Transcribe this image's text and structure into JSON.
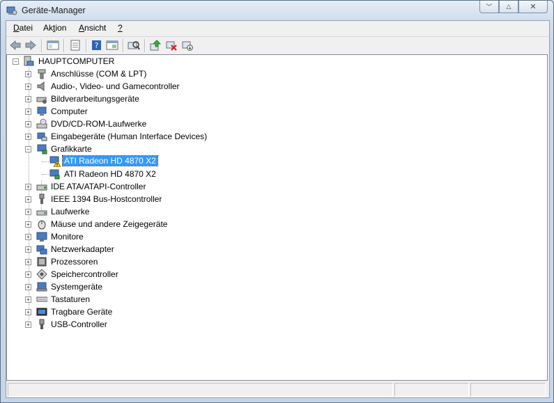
{
  "window": {
    "title": "Geräte-Manager"
  },
  "menu": [
    {
      "pre": "",
      "key": "D",
      "post": "atei"
    },
    {
      "pre": "Ak",
      "key": "t",
      "post": "ion"
    },
    {
      "pre": "",
      "key": "A",
      "post": "nsicht"
    },
    {
      "pre": "",
      "key": "?",
      "post": ""
    }
  ],
  "toolbar": [
    "back-icon",
    "forward-icon",
    "tree-view-icon",
    "properties-icon",
    "help-icon",
    "console-icon",
    "scan-hardware-icon",
    "update-driver-icon",
    "uninstall-icon",
    "disable-icon"
  ],
  "tree": {
    "root": "HAUPTCOMPUTER",
    "categories": [
      "Anschlüsse (COM & LPT)",
      "Audio-, Video- und Gamecontroller",
      "Bildverarbeitungsgeräte",
      "Computer",
      "DVD/CD-ROM-Laufwerke",
      "Eingabegeräte (Human Interface Devices)",
      "Grafikkarte",
      "IDE ATA/ATAPI-Controller",
      "IEEE 1394 Bus-Hostcontroller",
      "Laufwerke",
      "Mäuse und andere Zeigegeräte",
      "Monitore",
      "Netzwerkadapter",
      "Prozessoren",
      "Speichercontroller",
      "Systemgeräte",
      "Tastaturen",
      "Tragbare Geräte",
      "USB-Controller"
    ],
    "graphics_children": [
      "ATI Radeon HD 4870 X2",
      "ATI Radeon HD 4870 X2"
    ]
  }
}
